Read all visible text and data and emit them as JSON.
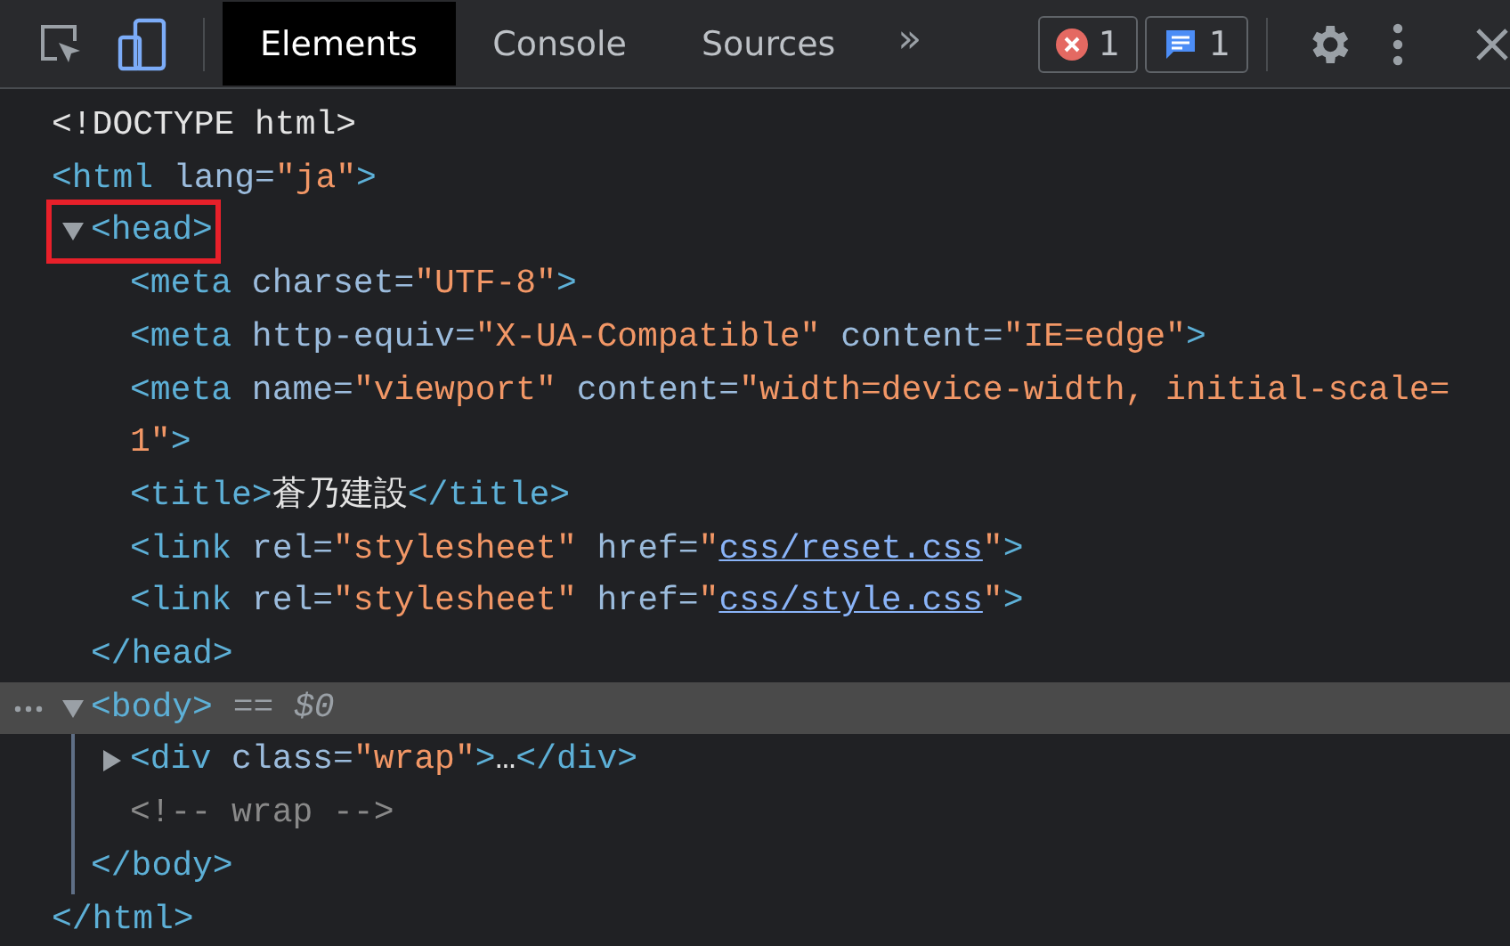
{
  "toolbar": {
    "inspect_tool": {
      "on": false
    },
    "device_toolbar": {
      "on": true
    },
    "tabs": [
      {
        "label": "Elements",
        "selected": true
      },
      {
        "label": "Console",
        "selected": false
      },
      {
        "label": "Sources",
        "selected": false
      }
    ],
    "more_tabs": "»",
    "error_badge": {
      "count": "1"
    },
    "message_badge": {
      "count": "1"
    }
  },
  "dom_tree": [
    {
      "tokens": [
        {
          "kind": "doctype",
          "text": "<!DOCTYPE html>"
        }
      ]
    },
    {
      "tokens": [
        {
          "kind": "tag",
          "text": "<html "
        },
        {
          "kind": "attr",
          "text": "lang="
        },
        {
          "kind": "value",
          "text": "\"ja\""
        },
        {
          "kind": "tag",
          "text": ">"
        }
      ],
      "children": [
        {
          "tokens": [
            {
              "kind": "tag",
              "text": "<head>"
            }
          ],
          "expanded": true,
          "annotated": true,
          "selected": false,
          "children": [
            {
              "tokens": [
                {
                  "kind": "tag",
                  "text": "<meta "
                },
                {
                  "kind": "attr",
                  "text": "charset="
                },
                {
                  "kind": "value",
                  "text": "\"UTF-8\""
                },
                {
                  "kind": "tag",
                  "text": ">"
                }
              ]
            },
            {
              "tokens": [
                {
                  "kind": "tag",
                  "text": "<meta "
                },
                {
                  "kind": "attr",
                  "text": "http-equiv="
                },
                {
                  "kind": "value",
                  "text": "\"X-UA-Compatible\""
                },
                {
                  "kind": "attr",
                  "text": " content="
                },
                {
                  "kind": "value",
                  "text": "\"IE=edge\""
                },
                {
                  "kind": "tag",
                  "text": ">"
                }
              ]
            },
            {
              "tokens": [
                {
                  "kind": "tag",
                  "text": "<meta "
                },
                {
                  "kind": "attr",
                  "text": "name="
                },
                {
                  "kind": "value",
                  "text": "\"viewport\""
                },
                {
                  "kind": "attr",
                  "text": " content="
                },
                {
                  "kind": "value",
                  "text": "\"width=device-width, initial-scale=1\""
                },
                {
                  "kind": "tag",
                  "text": ">"
                }
              ]
            },
            {
              "tokens": [
                {
                  "kind": "tag",
                  "text": "<title>"
                },
                {
                  "kind": "text",
                  "text": "蒼乃建設"
                },
                {
                  "kind": "tag",
                  "text": "</title>"
                }
              ]
            },
            {
              "tokens": [
                {
                  "kind": "tag",
                  "text": "<link "
                },
                {
                  "kind": "attr",
                  "text": "rel="
                },
                {
                  "kind": "value",
                  "text": "\"stylesheet\""
                },
                {
                  "kind": "attr",
                  "text": " href="
                },
                {
                  "kind": "value",
                  "text": "\""
                },
                {
                  "kind": "link",
                  "text": "css/reset.css"
                },
                {
                  "kind": "value",
                  "text": "\""
                },
                {
                  "kind": "tag",
                  "text": ">"
                }
              ]
            },
            {
              "tokens": [
                {
                  "kind": "tag",
                  "text": "<link "
                },
                {
                  "kind": "attr",
                  "text": "rel="
                },
                {
                  "kind": "value",
                  "text": "\"stylesheet\""
                },
                {
                  "kind": "attr",
                  "text": " href="
                },
                {
                  "kind": "value",
                  "text": "\""
                },
                {
                  "kind": "link",
                  "text": "css/style.css"
                },
                {
                  "kind": "value",
                  "text": "\""
                },
                {
                  "kind": "tag",
                  "text": ">"
                }
              ]
            }
          ],
          "close": [
            {
              "kind": "tag",
              "text": "</head>"
            }
          ]
        },
        {
          "tokens": [
            {
              "kind": "tag",
              "text": "<body>"
            },
            {
              "kind": "ref",
              "text": " == $0"
            }
          ],
          "expanded": true,
          "selected": true,
          "children": [
            {
              "tokens": [
                {
                  "kind": "tag",
                  "text": "<div "
                },
                {
                  "kind": "attr",
                  "text": "class="
                },
                {
                  "kind": "value",
                  "text": "\"wrap\""
                },
                {
                  "kind": "tag",
                  "text": ">"
                },
                {
                  "kind": "text",
                  "text": "…"
                },
                {
                  "kind": "tag",
                  "text": "</div>"
                }
              ],
              "expanded": false
            },
            {
              "tokens": [
                {
                  "kind": "comment",
                  "text": "<!-- wrap -->"
                }
              ]
            }
          ],
          "close": [
            {
              "kind": "tag",
              "text": "</body>"
            }
          ]
        }
      ],
      "close": [
        {
          "kind": "tag",
          "text": "</html>"
        }
      ]
    }
  ]
}
